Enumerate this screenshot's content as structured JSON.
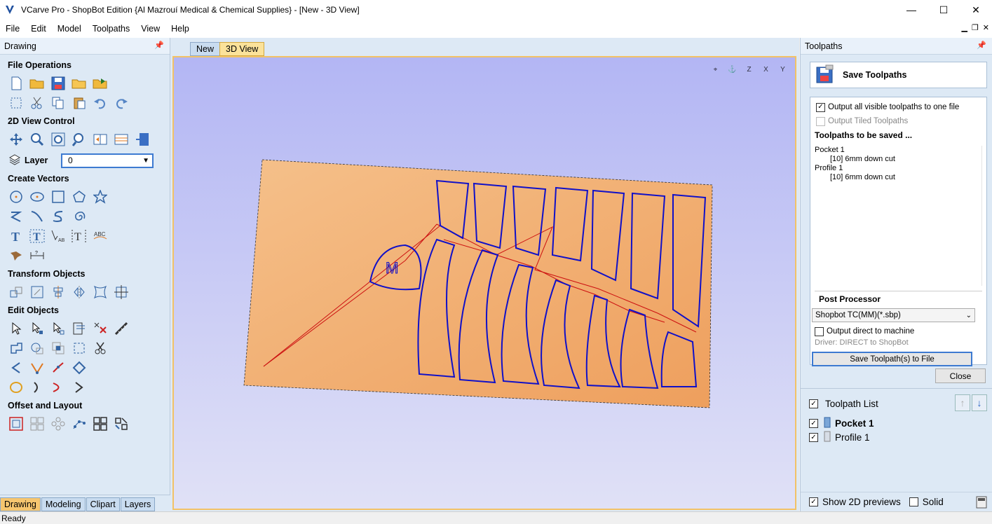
{
  "window": {
    "title": "VCarve Pro - ShopBot Edition {Al Mazrouí Medical & Chemical Supplies} - [New - 3D View]",
    "minimize": "—",
    "maximize": "☐",
    "close": "✕"
  },
  "menu": [
    "File",
    "Edit",
    "Model",
    "Toolpaths",
    "View",
    "Help"
  ],
  "left_panel": {
    "title": "Drawing",
    "sections": {
      "file_operations": "File Operations",
      "view_control": "2D View Control",
      "create_vectors": "Create Vectors",
      "transform_objects": "Transform Objects",
      "edit_objects": "Edit Objects",
      "offset_layout": "Offset and Layout"
    },
    "layer_label": "Layer",
    "layer_value": "0",
    "bottom_tabs": [
      "Drawing",
      "Modeling",
      "Clipart",
      "Layers"
    ]
  },
  "doc_tabs": [
    "New",
    "3D View"
  ],
  "view_tools": [
    "⌖",
    "⚓",
    "Z",
    "X",
    "Y"
  ],
  "right_panel": {
    "title": "Toolpaths",
    "save_title": "Save Toolpaths",
    "output_all_label": "Output all visible toolpaths to one file",
    "output_tiled_label": "Output Tiled Toolpaths",
    "to_be_saved_label": "Toolpaths to be saved ...",
    "toolpaths": [
      {
        "name": "Pocket 1",
        "tool": "[10] 6mm down cut"
      },
      {
        "name": "Profile 1",
        "tool": "[10] 6mm down cut"
      }
    ],
    "post_processor_label": "Post Processor",
    "post_processor_value": "Shopbot TC(MM)(*.sbp)",
    "output_direct_label": "Output direct to machine",
    "driver_label": "Driver: DIRECT to ShopBot",
    "save_button": "Save Toolpath(s) to File",
    "close_button": "Close",
    "toolpath_list_label": "Toolpath List",
    "list_items": [
      "Pocket 1",
      "Profile 1"
    ],
    "show_previews_label": "Show 2D previews",
    "solid_label": "Solid"
  },
  "status": "Ready",
  "model": {
    "logo_letter": "M"
  },
  "colors": {
    "accent": "#3d7ad1",
    "wood": "#f0b06e",
    "vector": "#1010c8",
    "toolpath_red": "#cc1010"
  }
}
